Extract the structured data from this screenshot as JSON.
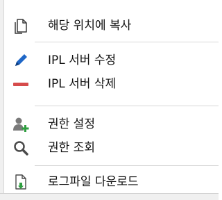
{
  "context_menu": {
    "items": [
      {
        "label": "해당 위치에 복사",
        "icon": "copy-icon"
      },
      {
        "label": "IPL 서버 수정",
        "icon": "pencil-icon"
      },
      {
        "label": "IPL 서버 삭제",
        "icon": "minus-icon"
      },
      {
        "label": "권한 설정",
        "icon": "user-add-icon"
      },
      {
        "label": "권한 조회",
        "icon": "search-icon"
      },
      {
        "label": "로그파일 다운로드",
        "icon": "download-file-icon"
      }
    ]
  },
  "colors": {
    "accent_blue": "#1f67c7",
    "danger_red": "#d64b4b",
    "success_green": "#2e9e3f"
  }
}
